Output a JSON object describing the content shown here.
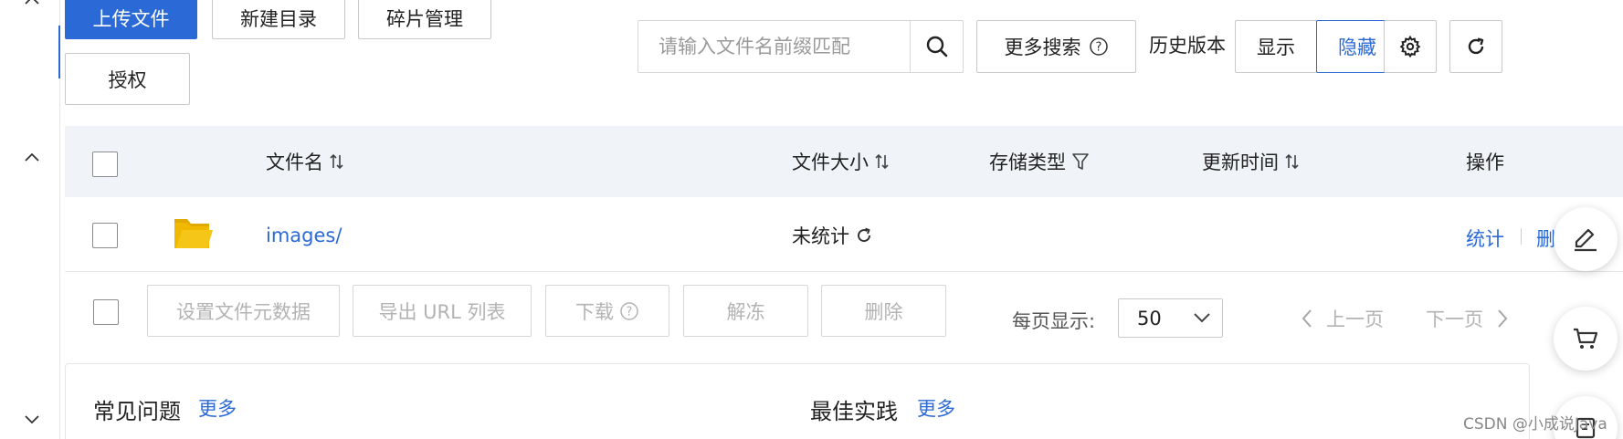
{
  "toolbar": {
    "upload_label": "上传文件",
    "new_dir_label": "新建目录",
    "fragments_label": "碎片管理",
    "authorize_label": "授权",
    "search_placeholder": "请输入文件名前缀匹配",
    "more_search_label": "更多搜索",
    "history_label": "历史版本",
    "show_label": "显示",
    "hide_label": "隐藏"
  },
  "table": {
    "columns": {
      "name": "文件名",
      "size": "文件大小",
      "storage_type": "存储类型",
      "updated": "更新时间",
      "actions": "操作"
    },
    "rows": [
      {
        "name": "images/",
        "size": "未统计",
        "storage_type": "",
        "updated": "",
        "action_stats": "统计",
        "action_delete": "删"
      }
    ]
  },
  "bulk_actions": {
    "set_metadata": "设置文件元数据",
    "export_urls": "导出 URL 列表",
    "download": "下载",
    "unfreeze": "解冻",
    "delete": "删除"
  },
  "pagination": {
    "per_page_label": "每页显示:",
    "per_page_value": "50",
    "prev_label": "上一页",
    "next_label": "下一页"
  },
  "faq": {
    "common_title": "常见问题",
    "common_more": "更多",
    "best_title": "最佳实践",
    "best_more": "更多"
  },
  "watermark": "CSDN @小成说Java",
  "colors": {
    "primary": "#2b6ad6",
    "folder": "#f5c518",
    "header_bg": "#f0f3f7"
  }
}
